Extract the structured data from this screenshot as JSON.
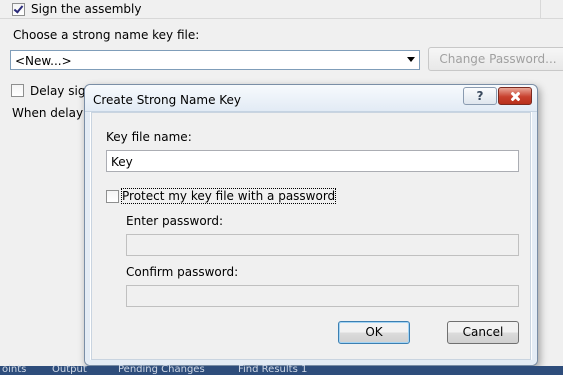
{
  "background": {
    "sign_assembly_label": "Sign the assembly",
    "choose_key_label": "Choose a strong name key file:",
    "key_combo_value": "<New...>",
    "change_password_label": "Change Password...",
    "delay_sign_label": "Delay sign",
    "when_delay_label": "When delay s"
  },
  "dialog": {
    "title": "Create Strong Name Key",
    "help_label": "?",
    "key_file_name_label": "Key file name:",
    "key_file_name_value": "Key",
    "protect_label": "Protect my key file with a password",
    "enter_password_label": "Enter password:",
    "confirm_password_label": "Confirm password:",
    "ok_label": "OK",
    "cancel_label": "Cancel"
  },
  "statusbar": {
    "items": [
      "oints",
      "Output",
      "Pending Changes",
      "Find Results 1"
    ]
  }
}
